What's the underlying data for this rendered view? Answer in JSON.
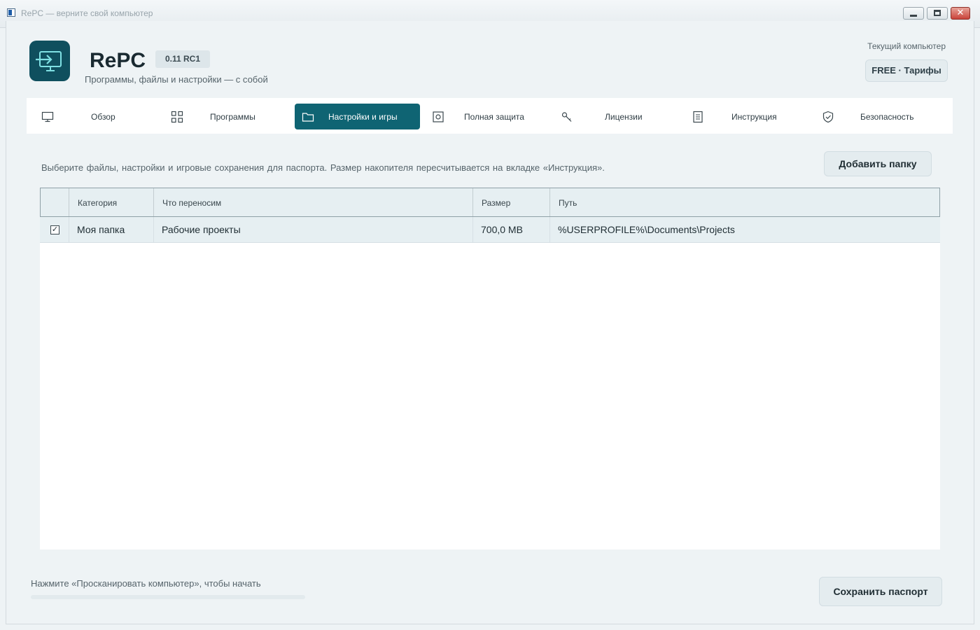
{
  "window": {
    "title": "RePC — верните свой компьютер"
  },
  "header": {
    "app_name": "RePC",
    "version": "0.11 RC1",
    "tagline": "Программы, файлы и настройки — с собой",
    "current_pc_label": "Текущий компьютер",
    "plan_button": "FREE · Тарифы"
  },
  "tabs": [
    {
      "label": "Обзор",
      "icon": "monitor-icon",
      "active": false
    },
    {
      "label": "Программы",
      "icon": "apps-grid-icon",
      "active": false
    },
    {
      "label": "Настройки и игры",
      "icon": "folder-icon",
      "active": true
    },
    {
      "label": "Полная защита",
      "icon": "disk-icon",
      "active": false
    },
    {
      "label": "Лицензии",
      "icon": "key-icon",
      "active": false
    },
    {
      "label": "Инструкция",
      "icon": "document-icon",
      "active": false
    },
    {
      "label": "Безопасность",
      "icon": "shield-icon",
      "active": false
    }
  ],
  "content": {
    "description": "Выберите файлы, настройки и игровые сохранения для паспорта. Размер накопителя пересчитывается на вкладке «Инструкция».",
    "add_folder_button": "Добавить папку",
    "table": {
      "columns": [
        "",
        "Категория",
        "Что переносим",
        "Размер",
        "Путь"
      ],
      "rows": [
        {
          "checked": true,
          "category": "Моя папка",
          "what": "Рабочие проекты",
          "size": "700,0 MB",
          "path": "%USERPROFILE%\\Documents\\Projects"
        }
      ]
    }
  },
  "footer": {
    "status": "Нажмите «Просканировать компьютер», чтобы начать",
    "progress": 0,
    "save_button": "Сохранить паспорт"
  },
  "colors": {
    "accent": "#0f6473",
    "logo_bg": "#0f4f5e",
    "logo_glyph": "#7fe0e3",
    "background": "#eef3f5"
  }
}
